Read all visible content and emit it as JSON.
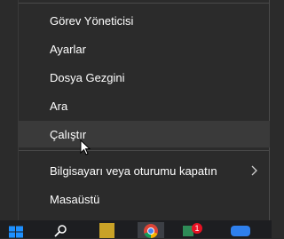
{
  "menu": {
    "items": [
      {
        "label": "Görev Yöneticisi"
      },
      {
        "label": "Ayarlar"
      },
      {
        "label": "Dosya Gezgini"
      },
      {
        "label": "Ara"
      },
      {
        "label": "Çalıştır"
      },
      {
        "label": "Bilgisayarı veya oturumu kapatın"
      },
      {
        "label": "Masaüstü"
      }
    ]
  },
  "taskbar": {
    "badge_count": "1"
  },
  "icons": {
    "start": "windows-start-icon",
    "search": "search-icon",
    "chevron": "chevron-right-icon",
    "cursor": "mouse-cursor-icon"
  },
  "colors": {
    "menu_bg": "#2b2b2b",
    "hover_bg": "#3a3a3a",
    "text": "#ffffff",
    "taskbar_bg": "#1d1e21",
    "badge": "#e81123"
  }
}
